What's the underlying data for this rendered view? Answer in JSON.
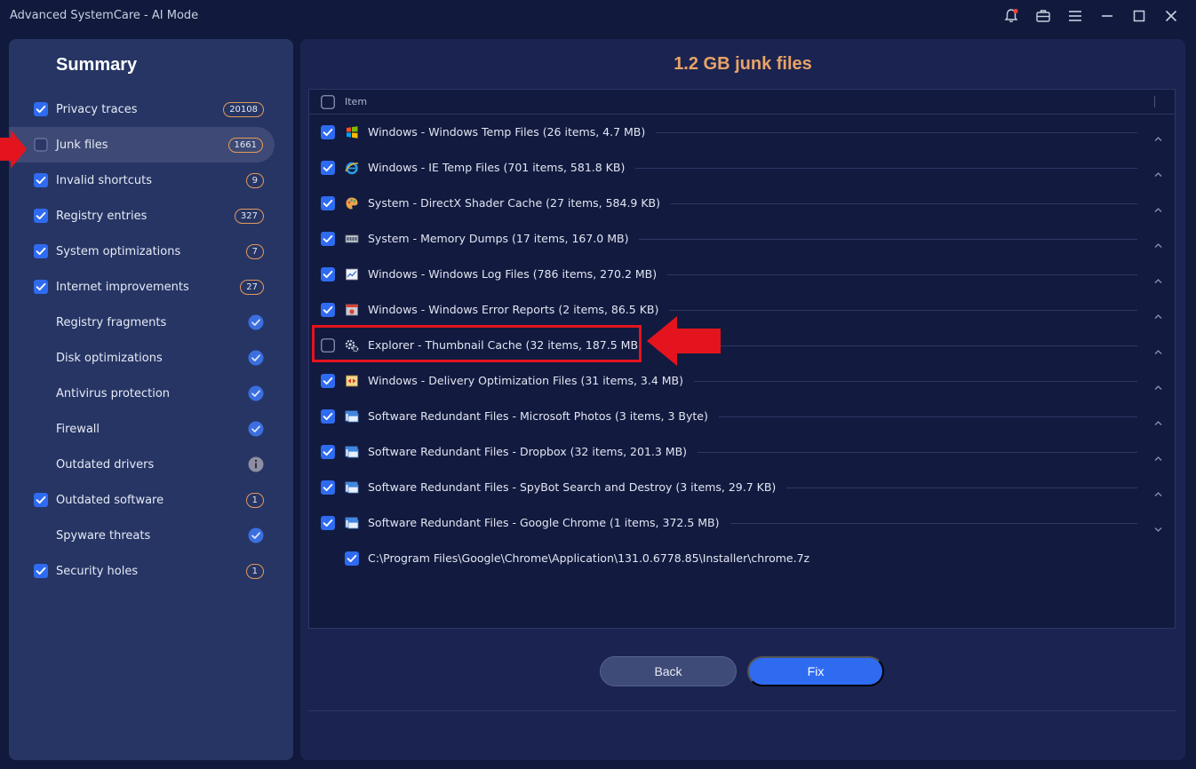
{
  "window": {
    "title": "Advanced SystemCare - AI Mode",
    "controls": [
      "notification-bell-icon",
      "toolbox-icon",
      "menu-icon",
      "minimize-icon",
      "maximize-icon",
      "close-icon"
    ]
  },
  "sidebar": {
    "title": "Summary",
    "items": [
      {
        "label": "Privacy traces",
        "checked": true,
        "badge": "20108",
        "status": "badge"
      },
      {
        "label": "Junk files",
        "checked": false,
        "badge": "1661",
        "status": "badge",
        "selected": true
      },
      {
        "label": "Invalid shortcuts",
        "checked": true,
        "badge": "9",
        "status": "badge"
      },
      {
        "label": "Registry entries",
        "checked": true,
        "badge": "327",
        "status": "badge"
      },
      {
        "label": "System optimizations",
        "checked": true,
        "badge": "7",
        "status": "badge"
      },
      {
        "label": "Internet improvements",
        "checked": true,
        "badge": "27",
        "status": "badge"
      },
      {
        "label": "Registry fragments",
        "checked": null,
        "badge": "",
        "status": "ok"
      },
      {
        "label": "Disk optimizations",
        "checked": null,
        "badge": "",
        "status": "ok"
      },
      {
        "label": "Antivirus protection",
        "checked": null,
        "badge": "",
        "status": "ok"
      },
      {
        "label": "Firewall",
        "checked": null,
        "badge": "",
        "status": "ok"
      },
      {
        "label": "Outdated drivers",
        "checked": null,
        "badge": "",
        "status": "info"
      },
      {
        "label": "Outdated software",
        "checked": true,
        "badge": "1",
        "status": "badge"
      },
      {
        "label": "Spyware threats",
        "checked": null,
        "badge": "",
        "status": "ok"
      },
      {
        "label": "Security holes",
        "checked": true,
        "badge": "1",
        "status": "badge"
      }
    ]
  },
  "main": {
    "title": "1.2 GB junk files",
    "header": {
      "label": "Item"
    },
    "rows": [
      {
        "label": "Windows - Windows Temp Files (26 items, 4.7 MB)",
        "checked": true,
        "icon": "windows-flag-icon",
        "chevron": "up"
      },
      {
        "label": "Windows - IE Temp Files (701 items, 581.8 KB)",
        "checked": true,
        "icon": "ie-icon",
        "chevron": "up"
      },
      {
        "label": "System - DirectX Shader Cache (27 items, 584.9 KB)",
        "checked": true,
        "icon": "palette-icon",
        "chevron": "up"
      },
      {
        "label": "System - Memory Dumps (17 items, 167.0 MB)",
        "checked": true,
        "icon": "memory-icon",
        "chevron": "up"
      },
      {
        "label": "Windows - Windows Log Files (786 items, 270.2 MB)",
        "checked": true,
        "icon": "log-chart-icon",
        "chevron": "up"
      },
      {
        "label": "Windows - Windows Error Reports (2 items, 86.5 KB)",
        "checked": true,
        "icon": "error-report-icon",
        "chevron": "up"
      },
      {
        "label": "Explorer - Thumbnail Cache (32 items, 187.5 MB)",
        "checked": false,
        "icon": "gears-icon",
        "chevron": "up"
      },
      {
        "label": "Windows - Delivery Optimization Files (31 items, 3.4 MB)",
        "checked": true,
        "icon": "delivery-icon",
        "chevron": "up"
      },
      {
        "label": "Software Redundant Files - Microsoft Photos (3 items, 3 Byte)",
        "checked": true,
        "icon": "app-window-icon",
        "chevron": "up"
      },
      {
        "label": "Software Redundant Files - Dropbox (32 items, 201.3 MB)",
        "checked": true,
        "icon": "app-window-icon",
        "chevron": "up"
      },
      {
        "label": "Software Redundant Files - SpyBot Search and Destroy (3 items, 29.7 KB)",
        "checked": true,
        "icon": "app-window-icon",
        "chevron": "up"
      },
      {
        "label": "Software Redundant Files - Google Chrome (1 items, 372.5 MB)",
        "checked": true,
        "icon": "app-window-icon",
        "chevron": "down"
      }
    ],
    "subrows": [
      {
        "label": "C:\\Program Files\\Google\\Chrome\\Application\\131.0.6778.85\\Installer\\chrome.7z",
        "checked": true
      }
    ]
  },
  "buttons": {
    "back": "Back",
    "fix": "Fix"
  },
  "colors": {
    "accent_blue": "#2f6bf1",
    "title_orange": "#e8a368",
    "badge_border": "#e39a5c",
    "annotation_red": "#e3141e"
  }
}
